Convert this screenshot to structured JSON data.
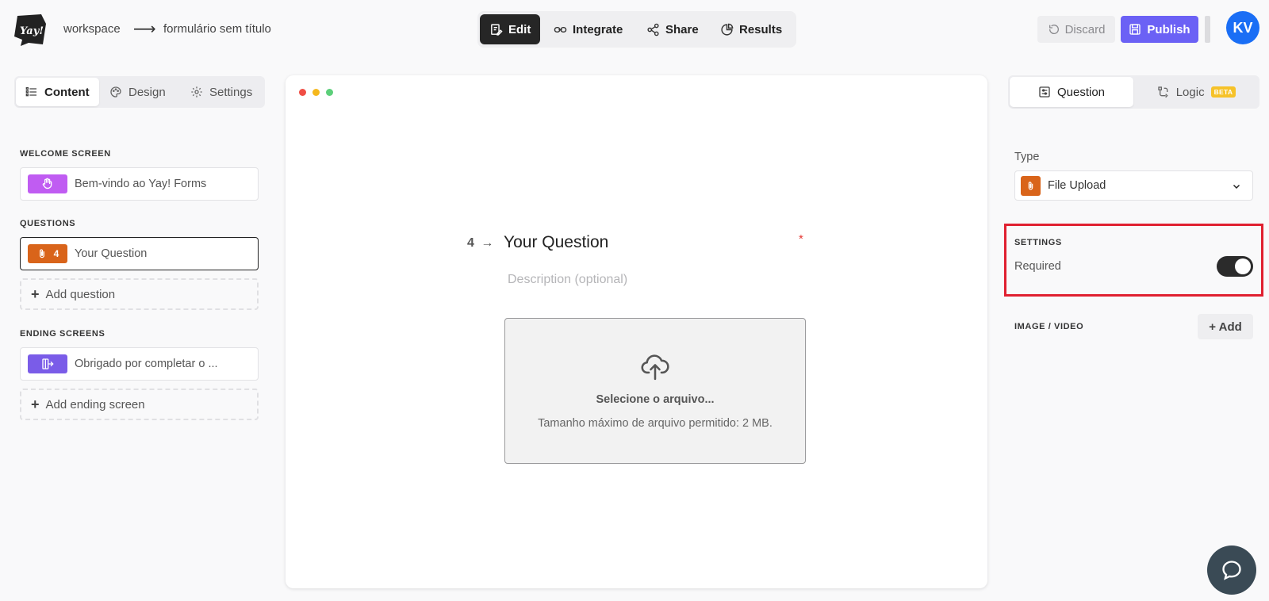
{
  "header": {
    "breadcrumb": {
      "workspace": "workspace",
      "separator": "⟶",
      "form_title": "formulário sem título"
    },
    "mode_tabs": [
      {
        "label": "Edit",
        "icon": "edit-icon",
        "active": true
      },
      {
        "label": "Integrate",
        "icon": "link-icon",
        "active": false
      },
      {
        "label": "Share",
        "icon": "share-icon",
        "active": false
      },
      {
        "label": "Results",
        "icon": "pie-chart-icon",
        "active": false
      }
    ],
    "discard_label": "Discard",
    "publish_label": "Publish",
    "avatar_initials": "KV",
    "avatar_color": "#1a6ef5",
    "publish_color": "#6b61f5"
  },
  "left_panel": {
    "tabs": [
      {
        "label": "Content",
        "icon": "list-icon",
        "active": true
      },
      {
        "label": "Design",
        "icon": "palette-icon",
        "active": false
      },
      {
        "label": "Settings",
        "icon": "gear-icon",
        "active": false
      }
    ],
    "welcome_section": {
      "label": "WELCOME SCREEN",
      "item": {
        "text": "Bem-vindo ao Yay! Forms",
        "icon": "hand-icon",
        "color": "#c05cf2"
      }
    },
    "questions_section": {
      "label": "QUESTIONS",
      "items": [
        {
          "text": "Your Question",
          "number": "4",
          "icon": "paperclip-icon",
          "color": "#d9641a",
          "selected": true
        }
      ],
      "add_label": "Add question"
    },
    "ending_section": {
      "label": "ENDING SCREENS",
      "item": {
        "text": "Obrigado por completar o ...",
        "icon": "exit-icon",
        "color": "#7a5ce8"
      },
      "add_label": "Add ending screen"
    }
  },
  "preview": {
    "question_number": "4",
    "question_arrow": "→",
    "question_title": "Your Question",
    "required_mark": "*",
    "description_placeholder": "Description (optional)",
    "upload_title": "Selecione o arquivo...",
    "upload_hint": "Tamanho máximo de arquivo permitido: 2 MB."
  },
  "right_panel": {
    "tabs": [
      {
        "label": "Question",
        "icon": "sliders-icon",
        "active": true
      },
      {
        "label": "Logic",
        "icon": "branch-icon",
        "active": false,
        "badge": "BETA"
      }
    ],
    "type_label": "Type",
    "type_value": "File Upload",
    "settings_title": "SETTINGS",
    "required_label": "Required",
    "required_on": true,
    "media_title": "IMAGE / VIDEO",
    "media_add_label": "+ Add",
    "highlight_color": "#e02030"
  }
}
